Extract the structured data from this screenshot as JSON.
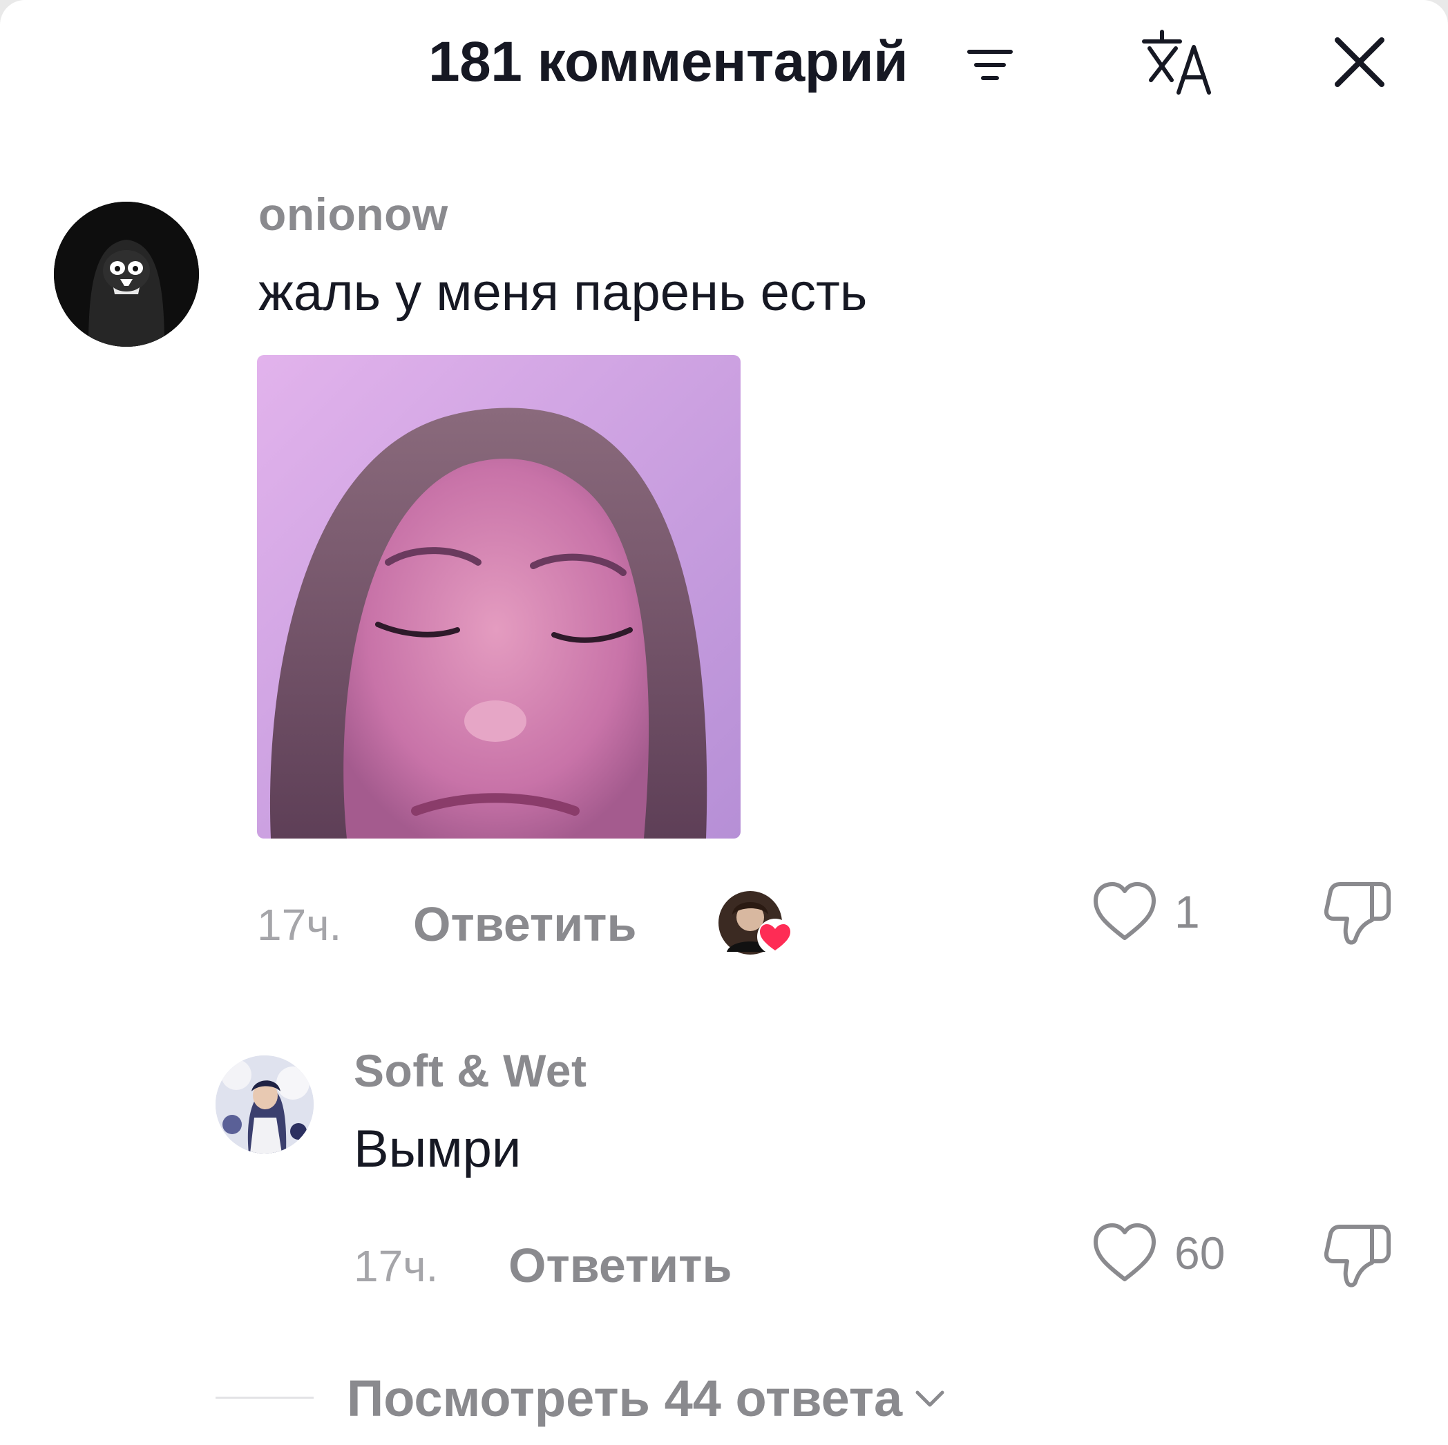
{
  "header": {
    "title": "181 комментарий",
    "filter_icon": "filter-icon",
    "translate_icon": "translate-icon",
    "close_icon": "close-icon"
  },
  "comments": [
    {
      "username": "onionow",
      "text": "жаль у меня парень есть",
      "has_image": true,
      "time": "17ч.",
      "reply_label": "Ответить",
      "creator_liked": true,
      "likes": "1"
    }
  ],
  "replies": [
    {
      "username": "Soft & Wet",
      "text": "Вымри",
      "time": "17ч.",
      "reply_label": "Ответить",
      "likes": "60"
    }
  ],
  "view_replies": {
    "label": "Посмотреть 44 ответа"
  },
  "colors": {
    "text_primary": "#161823",
    "text_secondary": "#8a8a8e",
    "heart_accent": "#fe2c55"
  }
}
